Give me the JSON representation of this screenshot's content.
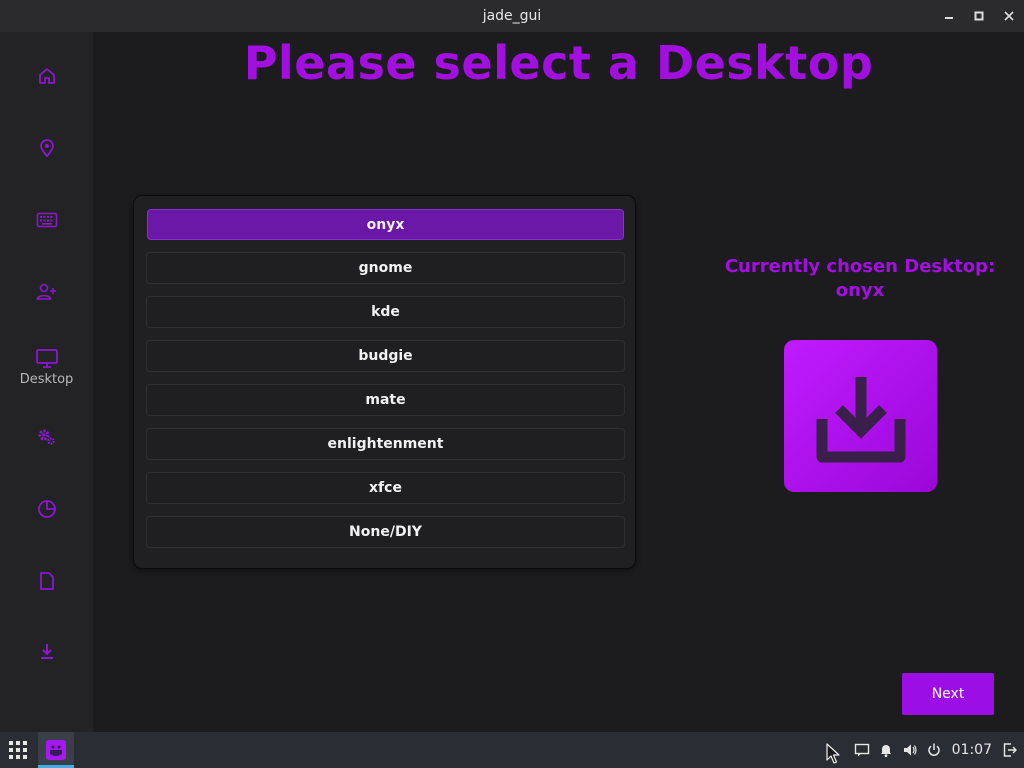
{
  "window": {
    "title": "jade_gui"
  },
  "sidebar": {
    "items": [
      {
        "icon": "home-icon"
      },
      {
        "icon": "location-pin-icon"
      },
      {
        "icon": "keyboard-icon"
      },
      {
        "icon": "add-user-icon"
      },
      {
        "icon": "desktop-icon",
        "label": "Desktop",
        "active": true
      },
      {
        "icon": "settings-gears-icon"
      },
      {
        "icon": "partition-icon"
      },
      {
        "icon": "document-icon"
      },
      {
        "icon": "install-icon"
      }
    ]
  },
  "main": {
    "title": "Please select a Desktop",
    "options": [
      "onyx",
      "gnome",
      "kde",
      "budgie",
      "mate",
      "enlightenment",
      "xfce",
      "None/DIY"
    ],
    "selected": "onyx",
    "chosen_label": "Currently chosen Desktop:",
    "chosen_value": "onyx",
    "next_label": "Next"
  },
  "taskbar": {
    "clock": "01:07"
  },
  "colors": {
    "accent": "#a20fe0",
    "selected": "#6b17a8",
    "sidebar_bg": "#232325",
    "main_bg": "#1c1c1e",
    "taskbar_bg": "#2a2d33"
  }
}
